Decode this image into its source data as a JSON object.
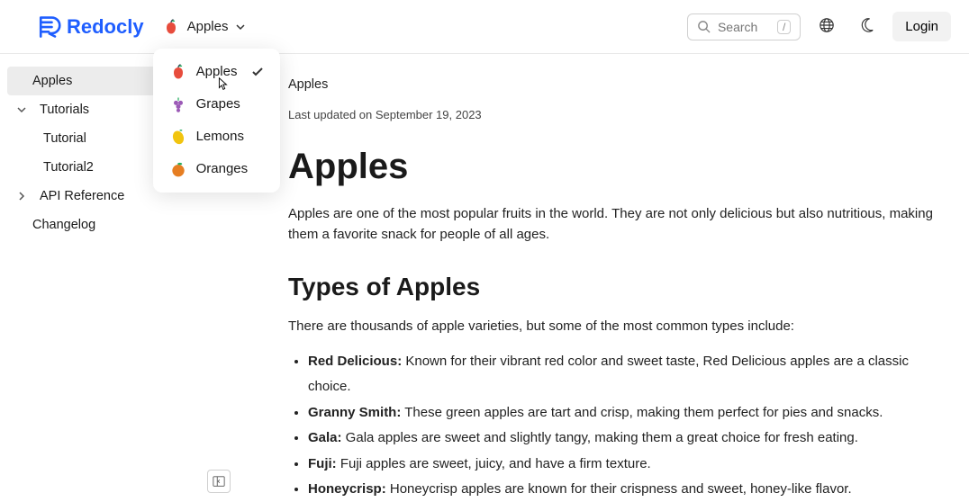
{
  "header": {
    "logo_text": "Redocly",
    "product_switcher": {
      "current": "Apples"
    },
    "search": {
      "placeholder": "Search",
      "kbd": "/"
    },
    "login": "Login"
  },
  "dropdown": {
    "items": [
      {
        "label": "Apples",
        "selected": true
      },
      {
        "label": "Grapes",
        "selected": false
      },
      {
        "label": "Lemons",
        "selected": false
      },
      {
        "label": "Oranges",
        "selected": false
      }
    ]
  },
  "sidebar": {
    "items": [
      {
        "label": "Apples",
        "active": true,
        "expandable": false
      },
      {
        "label": "Tutorials",
        "active": false,
        "expandable": true,
        "open": true
      },
      {
        "label": "Tutorial",
        "active": false,
        "child": true
      },
      {
        "label": "Tutorial2",
        "active": false,
        "child": true
      },
      {
        "label": "API Reference",
        "active": false,
        "expandable": true,
        "open": false
      },
      {
        "label": "Changelog",
        "active": false,
        "expandable": false
      }
    ]
  },
  "content": {
    "breadcrumb": "Apples",
    "last_updated": "Last updated on September 19, 2023",
    "h1": "Apples",
    "intro": "Apples are one of the most popular fruits in the world. They are not only delicious but also nutritious, making them a favorite snack for people of all ages.",
    "h2": "Types of Apples",
    "types_intro": "There are thousands of apple varieties, but some of the most common types include:",
    "types": [
      {
        "name": "Red Delicious:",
        "desc": " Known for their vibrant red color and sweet taste, Red Delicious apples are a classic choice."
      },
      {
        "name": "Granny Smith:",
        "desc": " These green apples are tart and crisp, making them perfect for pies and snacks."
      },
      {
        "name": "Gala:",
        "desc": " Gala apples are sweet and slightly tangy, making them a great choice for fresh eating."
      },
      {
        "name": "Fuji:",
        "desc": " Fuji apples are sweet, juicy, and have a firm texture."
      },
      {
        "name": "Honeycrisp:",
        "desc": " Honeycrisp apples are known for their crispness and sweet, honey-like flavor."
      }
    ]
  }
}
